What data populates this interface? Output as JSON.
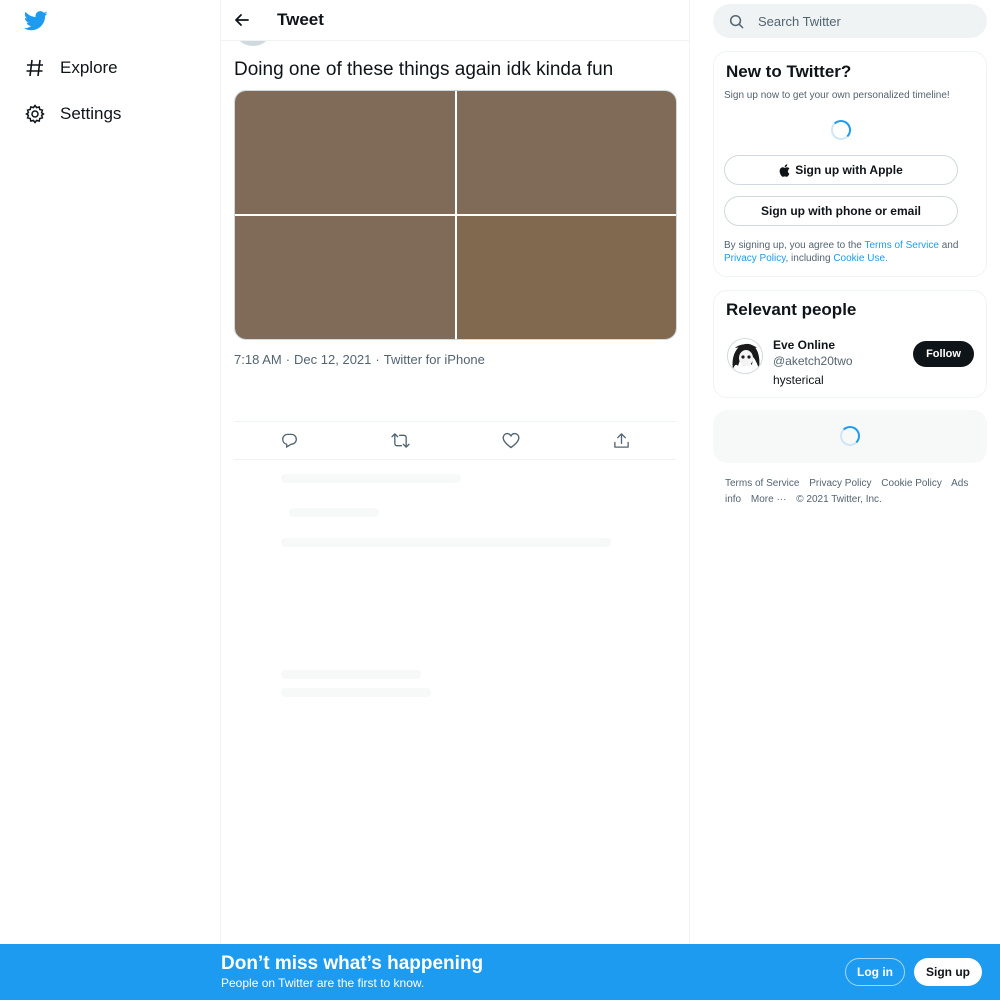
{
  "colors": {
    "brand": "#1d9bf0",
    "text": "#0f1419",
    "muted": "#536471",
    "media_tile": "#7f6b57"
  },
  "nav": {
    "logo_icon": "twitter-bird-icon",
    "items": [
      {
        "label": "Explore",
        "icon": "hashtag-icon"
      },
      {
        "label": "Settings",
        "icon": "gear-icon"
      }
    ]
  },
  "header": {
    "back_icon": "arrow-left-icon",
    "title": "Tweet"
  },
  "tweet": {
    "text": "Doing one of these things again idk kinda fun",
    "media_count": 4,
    "time": "7:18 AM",
    "separator": "·",
    "date": "Dec 12, 2021",
    "source": "Twitter for iPhone",
    "actions": [
      "reply-icon",
      "retweet-icon",
      "like-icon",
      "share-icon"
    ]
  },
  "search": {
    "placeholder": "Search Twitter",
    "icon": "search-icon"
  },
  "signup_card": {
    "title": "New to Twitter?",
    "subtitle": "Sign up now to get your own personalized timeline!",
    "apple_button": "Sign up with Apple",
    "phone_button": "Sign up with phone or email",
    "legal_prefix": "By signing up, you agree to the",
    "terms_link": "Terms of Service",
    "and": "and",
    "privacy_link": "Privacy Policy",
    "including": ", including",
    "cookie_link": "Cookie Use."
  },
  "people_card": {
    "title": "Relevant people",
    "person": {
      "name": "Eve Online",
      "handle": "@aketch20two",
      "bio": "hysterical",
      "follow_label": "Follow"
    }
  },
  "footer": {
    "links": [
      "Terms of Service",
      "Privacy Policy",
      "Cookie Policy",
      "Ads info",
      "More ···"
    ],
    "copyright": "© 2021 Twitter, Inc."
  },
  "bottom_bar": {
    "title": "Don’t miss what’s happening",
    "subtitle": "People on Twitter are the first to know.",
    "login": "Log in",
    "signup": "Sign up"
  }
}
